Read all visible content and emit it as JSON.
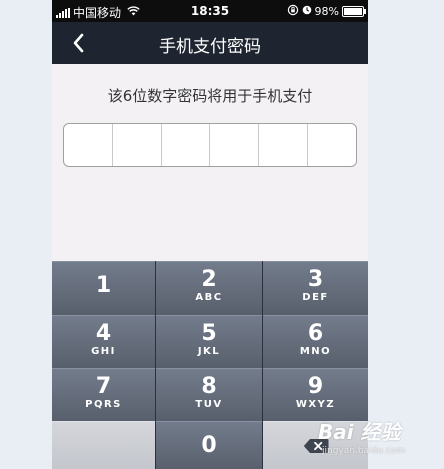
{
  "status_bar": {
    "carrier": "中国移动",
    "time": "18:35",
    "battery_percent": "98%",
    "battery_level": 0.98,
    "icons": [
      "signal-icon",
      "wifi-icon",
      "rotation-lock-icon",
      "alarm-icon",
      "battery-icon"
    ]
  },
  "nav": {
    "back_icon": "‹",
    "title": "手机支付密码"
  },
  "prompt": "该6位数字密码将用于手机支付",
  "pin": {
    "length": 6,
    "entered": 0
  },
  "keypad": {
    "keys": [
      {
        "num": "1",
        "letters": ""
      },
      {
        "num": "2",
        "letters": "ABC"
      },
      {
        "num": "3",
        "letters": "DEF"
      },
      {
        "num": "4",
        "letters": "GHI"
      },
      {
        "num": "5",
        "letters": "JKL"
      },
      {
        "num": "6",
        "letters": "MNO"
      },
      {
        "num": "7",
        "letters": "PQRS"
      },
      {
        "num": "8",
        "letters": "TUV"
      },
      {
        "num": "9",
        "letters": "WXYZ"
      },
      {
        "num": "0",
        "letters": ""
      }
    ],
    "delete_icon": "delete-icon"
  },
  "watermark": {
    "main": "Bai 经验",
    "sub": "jingyan.baidu.com"
  },
  "colors": {
    "nav_bg": "#1f2530",
    "status_bg": "#0d0d0d",
    "key_dark": "#5f6776",
    "key_light": "#c9ccd2",
    "page_bg": "#f3f1f4"
  }
}
